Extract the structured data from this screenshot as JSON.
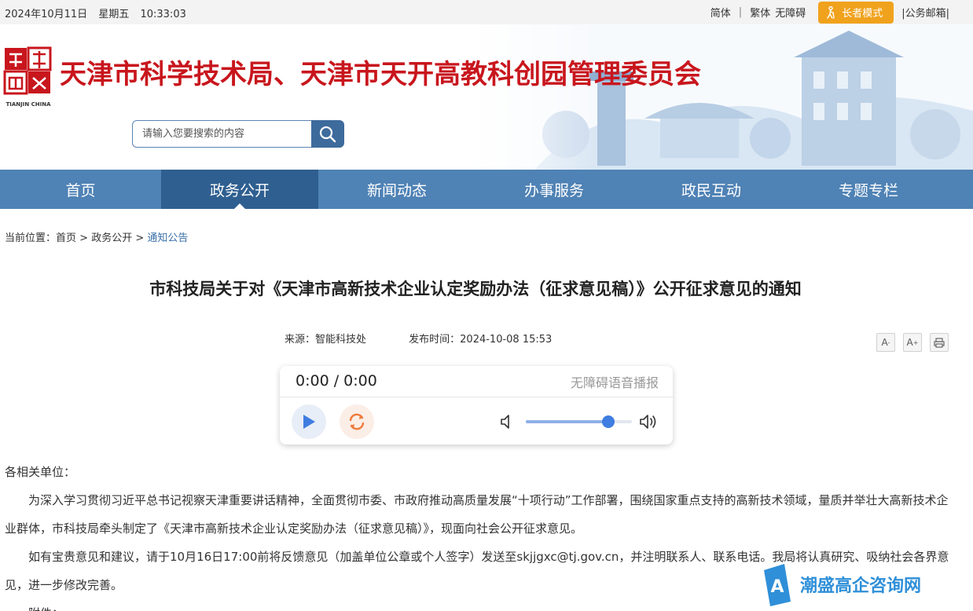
{
  "topbar": {
    "date": "2024年10月11日",
    "weekday": "星期五",
    "time": "10:33:03",
    "simplified": "简体",
    "separator": "|",
    "traditional": "繁体",
    "accessibility": "无障碍",
    "elder_mode": "长者模式",
    "mailbox": "|公务邮箱|"
  },
  "header": {
    "site_title": "天津市科学技术局、天津市天开高教科创园管理委员会",
    "logo_caption": "TIANJIN CHINA",
    "search_placeholder": "请输入您要搜索的内容"
  },
  "nav": {
    "items": [
      {
        "label": "首页"
      },
      {
        "label": "政务公开"
      },
      {
        "label": "新闻动态"
      },
      {
        "label": "办事服务"
      },
      {
        "label": "政民互动"
      },
      {
        "label": "专题专栏"
      }
    ],
    "active_index": 1
  },
  "breadcrumb": {
    "prefix": "当前位置：",
    "home": "首页",
    "sep": ">",
    "level1": "政务公开",
    "current": "通知公告"
  },
  "article": {
    "title": "市科技局关于对《天津市高新技术企业认定奖励办法（征求意见稿）》公开征求意见的通知",
    "source": "来源：智能科技处",
    "publish_time": "发布时间：2024-10-08 15:53",
    "greeting": "各相关单位：",
    "para1": "为深入学习贯彻习近平总书记视察天津重要讲话精神，全面贯彻市委、市政府推动高质量发展“十项行动”工作部署，围绕国家重点支持的高新技术领域，量质并举壮大高新技术企业群体，市科技局牵头制定了《天津市高新技术企业认定奖励办法（征求意见稿）》，现面向社会公开征求意见。",
    "para2": "如有宝贵意见和建议，请于10月16日17:00前将反馈意见（加盖单位公章或个人签字）发送至skjjgxc@tj.gov.cn，并注明联系人、联系电话。我局将认真研究、吸纳社会各界意见，进一步修改完善。",
    "attachment": "附件："
  },
  "tools": {
    "font_smaller": "A",
    "font_larger": "A",
    "minus": "-",
    "plus": "+"
  },
  "player": {
    "time": "0:00 / 0:00",
    "label": "无障碍语音播报",
    "volume": 0.78,
    "accent": "#3f7de0"
  },
  "watermark": {
    "text": "潮盛高企咨询网"
  },
  "colors": {
    "nav": "#4f82b5",
    "nav_active": "#2f5f90",
    "title_red": "#c8161d",
    "elder_orange": "#f0a21d"
  }
}
